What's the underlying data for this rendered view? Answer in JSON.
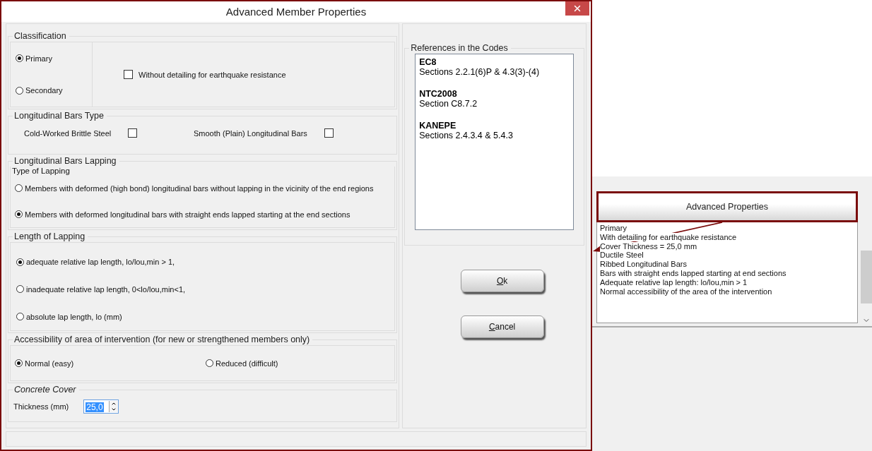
{
  "dialog": {
    "title": "Advanced Member Properties"
  },
  "classification": {
    "label": "Classification",
    "options": [
      {
        "label": "Primary",
        "selected": true
      },
      {
        "label": "Secondary",
        "selected": false
      }
    ],
    "checkbox": {
      "label": "Without detailing for earthquake resistance",
      "checked": false
    }
  },
  "bars_type": {
    "label": "Longitudinal Bars Type",
    "checkboxes": [
      {
        "label": "Cold-Worked Brittle Steel",
        "checked": false
      },
      {
        "label": "Smooth (Plain) Longitudinal Bars",
        "checked": false
      }
    ]
  },
  "lapping": {
    "label": "Longitudinal Bars Lapping",
    "sub_label": "Type of Lapping",
    "options": [
      {
        "label": "Members with deformed (high bond) longitudinal bars without lapping in the vicinity of the end regions",
        "selected": false
      },
      {
        "label": "Members with deformed longitudinal bars with straight ends lapped starting at the end sections",
        "selected": true
      }
    ]
  },
  "length_of_lapping": {
    "label": "Length of Lapping",
    "options": [
      {
        "label": "adequate relative lap length,  lo/lou,min > 1,",
        "selected": true
      },
      {
        "label": "inadequate relative lap length,  0<lo/lou,min<1,",
        "selected": false
      },
      {
        "label": "absolute lap length, lo (mm)",
        "selected": false
      }
    ]
  },
  "accessibility": {
    "label": "Accessibility of area of intervention (for new or strengthened members only)",
    "options": [
      {
        "label": "Normal (easy)",
        "selected": true
      },
      {
        "label": "Reduced (difficult)",
        "selected": false
      }
    ]
  },
  "concrete_cover": {
    "label": "Concrete Cover",
    "field": {
      "label": "Thickness (mm)",
      "value": "25,0"
    }
  },
  "references": {
    "label": "References in the Codes",
    "entries": [
      {
        "code": "EC8",
        "text": "Sections 2.2.1(6)P & 4.3(3)-(4)"
      },
      {
        "code": "NTC2008",
        "text": "Section C8.7.2"
      },
      {
        "code": "KANEPE",
        "text": "Sections 2.4.3.4 & 5.4.3"
      }
    ]
  },
  "buttons": [
    {
      "label": "Ok",
      "underline_first": true
    },
    {
      "label": "Cancel",
      "underline_first": true
    }
  ],
  "side_panel": {
    "button": "Advanced Properties",
    "lines": [
      "Primary",
      "With detailing for earthquake resistance",
      "Cover Thickness = 25,0 mm",
      "Ductile Steel",
      "Ribbed Longitudinal Bars",
      "Bars with straight ends lapped starting at end sections",
      "Adequate relative lap length: lo/lou,min > 1",
      "Normal accessibility of the area of the intervention"
    ]
  }
}
